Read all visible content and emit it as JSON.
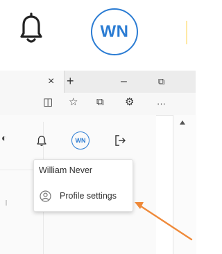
{
  "zoom": {
    "avatar_initials": "WN"
  },
  "browser": {
    "tab_close": "×",
    "new_tab": "+",
    "minimize": "–",
    "restore": "⧉",
    "toolbar": {
      "split_screen": "◫",
      "favorites": "☆",
      "collections": "⧉",
      "extension": "⚙",
      "more": "···"
    }
  },
  "app": {
    "avatar_initials": "WN",
    "user_menu": {
      "user_name": "William Never",
      "profile_settings_label": "Profile settings"
    }
  },
  "colors": {
    "accent": "#2b7cd3",
    "arrow": "#ef8a3a"
  }
}
